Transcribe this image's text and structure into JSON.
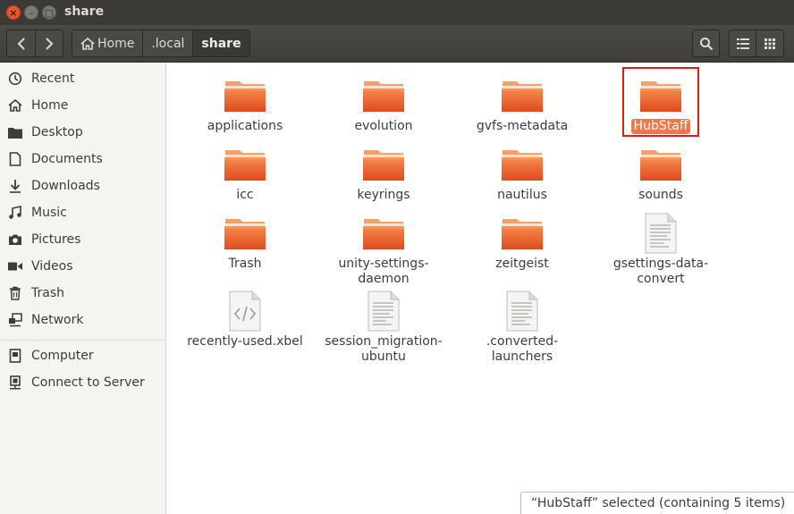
{
  "window": {
    "title": "share"
  },
  "toolbar": {
    "path": [
      {
        "label": "Home",
        "icon": "home-icon"
      },
      {
        "label": ".local"
      },
      {
        "label": "share"
      }
    ]
  },
  "sidebar": {
    "places": [
      {
        "label": "Recent",
        "icon": "clock-icon"
      },
      {
        "label": "Home",
        "icon": "home-icon"
      },
      {
        "label": "Desktop",
        "icon": "folder-icon"
      },
      {
        "label": "Documents",
        "icon": "document-icon"
      },
      {
        "label": "Downloads",
        "icon": "download-icon"
      },
      {
        "label": "Music",
        "icon": "music-icon"
      },
      {
        "label": "Pictures",
        "icon": "camera-icon"
      },
      {
        "label": "Videos",
        "icon": "video-icon"
      },
      {
        "label": "Trash",
        "icon": "trash-icon"
      },
      {
        "label": "Network",
        "icon": "network-icon"
      }
    ],
    "devices": [
      {
        "label": "Computer",
        "icon": "computer-icon"
      },
      {
        "label": "Connect to Server",
        "icon": "server-icon"
      }
    ]
  },
  "files": [
    {
      "name": "applications",
      "type": "folder"
    },
    {
      "name": "evolution",
      "type": "folder"
    },
    {
      "name": "gvfs-metadata",
      "type": "folder"
    },
    {
      "name": "HubStaff",
      "type": "folder",
      "selected": true
    },
    {
      "name": "icc",
      "type": "folder"
    },
    {
      "name": "keyrings",
      "type": "folder"
    },
    {
      "name": "nautilus",
      "type": "folder"
    },
    {
      "name": "sounds",
      "type": "folder"
    },
    {
      "name": "Trash",
      "type": "folder"
    },
    {
      "name": "unity-settings-\ndaemon",
      "type": "folder"
    },
    {
      "name": "zeitgeist",
      "type": "folder"
    },
    {
      "name": "gsettings-data-\nconvert",
      "type": "text"
    },
    {
      "name": "recently-used.xbel",
      "type": "xml"
    },
    {
      "name": "session_migration-\nubuntu",
      "type": "text"
    },
    {
      "name": ".converted-\nlaunchers",
      "type": "text"
    }
  ],
  "status": {
    "text": "“HubStaff” selected  (containing 5 items)"
  },
  "colors": {
    "accent": "#f07746",
    "folder": "#e8552a",
    "titlebar": "#3b3a36"
  }
}
